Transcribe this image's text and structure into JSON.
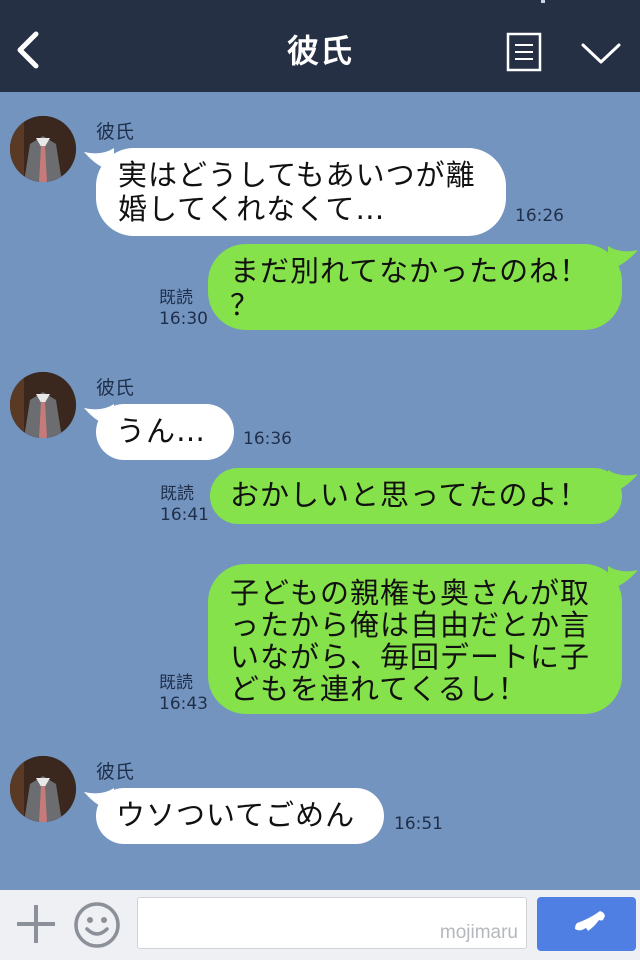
{
  "header": {
    "title": "彼氏"
  },
  "messages": [
    {
      "sender": "彼氏",
      "text": "実はどうしてもあいつが離\n婚してくれなくて…",
      "time": "16:26"
    },
    {
      "read": "既読",
      "time": "16:30",
      "text": "まだ別れてなかったのね！\n？"
    },
    {
      "sender": "彼氏",
      "text": "うん…",
      "time": "16:36"
    },
    {
      "read": "既読",
      "time": "16:41",
      "text": "おかしいと思ってたのよ！"
    },
    {
      "read": "既読",
      "time": "16:43",
      "text": "子どもの親権も奥さんが取\nったから俺は自由だとか言\nいながら、毎回デートに子\nどもを連れてくるし！"
    },
    {
      "sender": "彼氏",
      "text": "ウソついてごめん",
      "time": "16:51"
    }
  ],
  "input": {
    "watermark": "mojimaru"
  },
  "icons": {
    "back": "back-arrow-icon",
    "menu": "menu-list-icon",
    "collapse": "chevron-down-icon",
    "add": "plus-icon",
    "sticker": "smiley-icon",
    "call": "phone-icon"
  },
  "colors": {
    "header": "#253044",
    "chat_background": "#7494c0",
    "incoming_bubble": "#ffffff",
    "outgoing_bubble": "#86e24a",
    "call_button": "#4f7fe3"
  }
}
